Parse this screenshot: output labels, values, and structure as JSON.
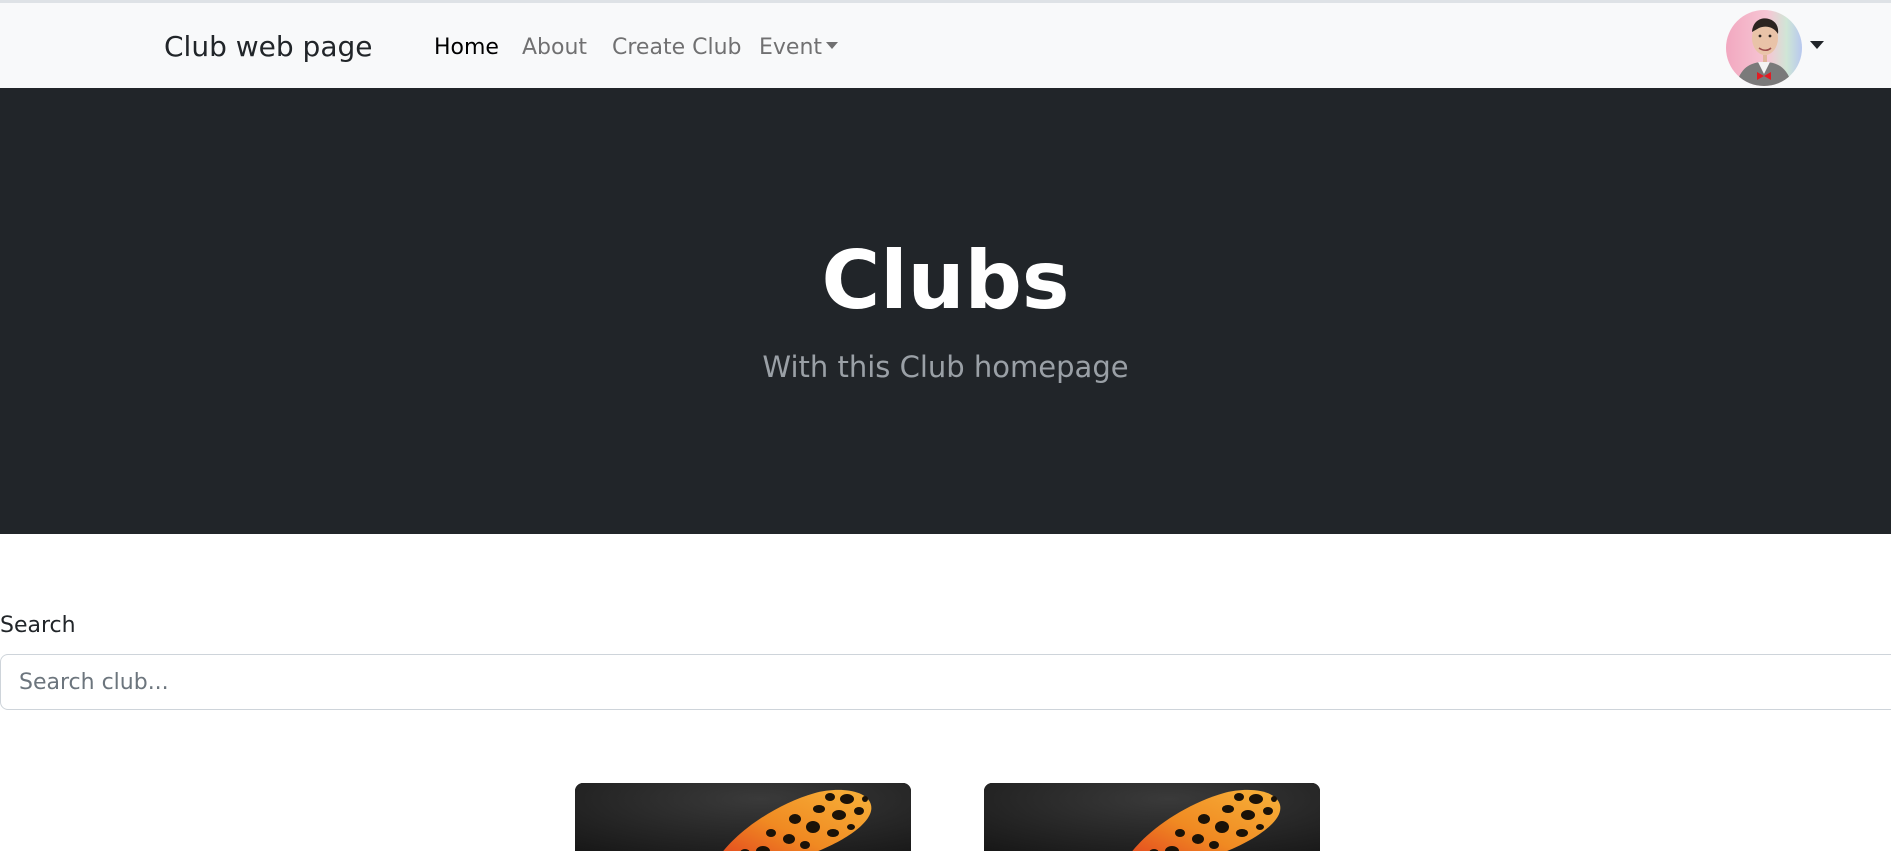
{
  "navbar": {
    "brand": "Club web page",
    "links": [
      {
        "label": "Home",
        "active": true
      },
      {
        "label": "About",
        "active": false
      },
      {
        "label": "Create Club",
        "active": false
      },
      {
        "label": "Event",
        "active": false,
        "dropdown": true
      }
    ],
    "profile": {
      "avatar_icon": "user-avatar-image",
      "dropdown_icon": "caret-down-icon"
    }
  },
  "hero": {
    "title": "Clubs",
    "subtitle": "With this Club homepage"
  },
  "search": {
    "label": "Search",
    "placeholder": "Search club...",
    "value": ""
  },
  "cards": [
    {
      "image": "leopard-gecko-image"
    },
    {
      "image": "leopard-gecko-image"
    }
  ],
  "colors": {
    "navbar_bg": "#f8f9fa",
    "hero_bg": "#212529",
    "hero_title": "#ffffff",
    "hero_subtitle": "#9aa0a6"
  }
}
